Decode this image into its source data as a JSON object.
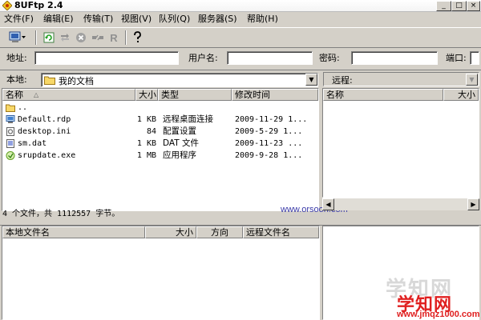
{
  "window": {
    "title": "8UFtp 2.4",
    "minimize": "_",
    "maximize": "□",
    "close": "×"
  },
  "menu": [
    "文件(F)",
    "编辑(E)",
    "传输(T)",
    "视图(V)",
    "队列(Q)",
    "服务器(S)",
    "帮助(H)"
  ],
  "connection": {
    "address_label": "地址:",
    "address_value": "",
    "username_label": "用户名:",
    "username_value": "",
    "password_label": "密码:",
    "password_value": "",
    "port_label": "端口:"
  },
  "local": {
    "location_label": "本地:",
    "location_value": "我的文档",
    "columns": {
      "name": "名称",
      "size": "大小",
      "type": "类型",
      "modified": "修改时间"
    },
    "files": [
      {
        "name": "..",
        "size": "",
        "type": "",
        "modified": "",
        "icon": "folder-up-icon"
      },
      {
        "name": "Default.rdp",
        "size": "1 KB",
        "type": "远程桌面连接",
        "modified": "2009-11-29 1...",
        "icon": "rdp-file-icon"
      },
      {
        "name": "desktop.ini",
        "size": "84",
        "type": "配置设置",
        "modified": "2009-5-29 1...",
        "icon": "ini-file-icon"
      },
      {
        "name": "sm.dat",
        "size": "1 KB",
        "type": "DAT 文件",
        "modified": "2009-11-23 ...",
        "icon": "dat-file-icon"
      },
      {
        "name": "srupdate.exe",
        "size": "1 MB",
        "type": "应用程序",
        "modified": "2009-9-28 1...",
        "icon": "exe-file-icon"
      }
    ],
    "status": "4 个文件，共 1112557 字节。"
  },
  "remote": {
    "location_label": "远程:",
    "columns": {
      "name": "名称",
      "size": "大小"
    }
  },
  "queue": {
    "columns": {
      "local_name": "本地文件名",
      "size": "大小",
      "direction": "方向",
      "remote_name": "远程文件名"
    }
  },
  "watermarks": {
    "orsoon": "www.orsoon.com",
    "site_name": "学知网",
    "site_url": "www.jmqz1000.com"
  },
  "colors": {
    "window_bg": "#d4d0c8",
    "watermark_red": "#e02020",
    "watermark_blue": "#3a3aa8"
  }
}
